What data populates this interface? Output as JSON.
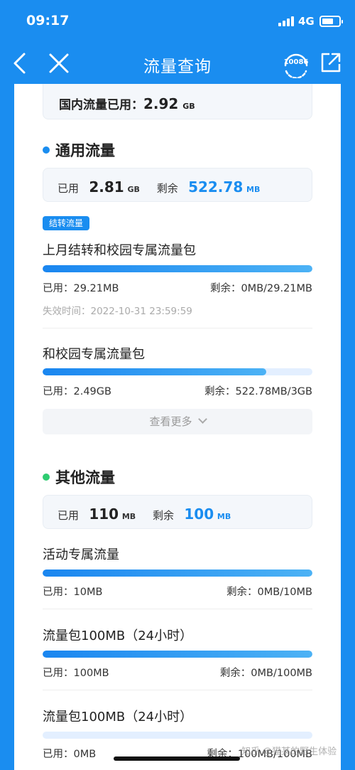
{
  "status": {
    "time": "09:17",
    "network": "4G"
  },
  "nav": {
    "title": "流量查询",
    "service_number": "10086"
  },
  "domestic": {
    "label": "国内流量已用：",
    "value": "2.92",
    "unit": "GB"
  },
  "general": {
    "title": "通用流量",
    "used_label": "已用",
    "used_value": "2.81",
    "used_unit": "GB",
    "remain_label": "剩余",
    "remain_value": "522.78",
    "remain_unit": "MB",
    "badge": "结转流量",
    "items": [
      {
        "title": "上月结转和校园专属流量包",
        "used": "已用：29.21MB",
        "remain": "剩余：0MB/29.21MB",
        "expire": "失效时间：2022-10-31 23:59:59",
        "progress": 1.0
      },
      {
        "title": "和校园专属流量包",
        "used": "已用：2.49GB",
        "remain": "剩余：522.78MB/3GB",
        "progress": 0.83
      }
    ],
    "more": "查看更多"
  },
  "other": {
    "title": "其他流量",
    "used_label": "已用",
    "used_value": "110",
    "used_unit": "MB",
    "remain_label": "剩余",
    "remain_value": "100",
    "remain_unit": "MB",
    "items": [
      {
        "title": "活动专属流量",
        "used": "已用：10MB",
        "remain": "剩余：0MB/10MB",
        "progress": 1.0
      },
      {
        "title": "流量包100MB（24小时）",
        "used": "已用：100MB",
        "remain": "剩余：0MB/100MB",
        "progress": 1.0
      },
      {
        "title": "流量包100MB（24小时）",
        "used": "已用：0MB",
        "remain": "剩余：100MB/100MB",
        "progress": 0.0
      }
    ]
  },
  "watermark": "知乎 @猫某的野生体验",
  "colors": {
    "accent": "#1a8df0",
    "general_dot": "#1a8df0",
    "other_dot": "#2ecc71"
  }
}
